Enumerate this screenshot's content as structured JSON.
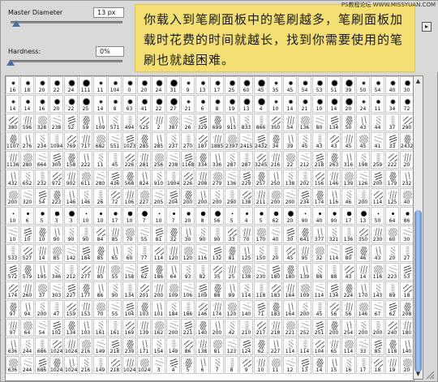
{
  "controls": {
    "master_diameter_label": "Master Diameter",
    "master_diameter_value": "13 px",
    "master_diameter_level": 0.05,
    "hardness_label": "Hardness:",
    "hardness_value": "0%",
    "hardness_level": 0.0,
    "options_icon": "options-triangle-icon"
  },
  "note": {
    "text": "你载入到笔刷面板中的笔刷越多，笔刷面板加载时花费的时间就越长，找到你需要使用的笔刷也就越困难。",
    "watermark": "PS教程论坛 WWW.MISSYUAN.COM"
  },
  "brush_grid": {
    "rows": [
      [
        "16",
        "18",
        "20",
        "22",
        "24",
        "111",
        "11",
        "104",
        "0",
        "20",
        "24",
        "31",
        "9",
        "13",
        "17",
        "25",
        "60",
        "45",
        "35",
        "45",
        "54",
        "53",
        "51",
        "39",
        "50",
        "54",
        "40",
        "30"
      ],
      [
        "14",
        "14",
        "16",
        "20",
        "22",
        "25",
        "14",
        "8",
        "63",
        "41",
        "22",
        "27",
        "21",
        "6",
        "8",
        "19",
        "13",
        "4",
        "10",
        "14",
        "21",
        "10",
        "14",
        "20",
        "24",
        "11",
        "34",
        "72"
      ],
      [
        "380",
        "596",
        "328",
        "238",
        "52",
        "59",
        "109",
        "571",
        "494",
        "525",
        "2",
        "387",
        "26",
        "329",
        "699",
        "915",
        "833",
        "866",
        "350",
        "54",
        "136",
        "80",
        "134",
        "50",
        "43",
        "44",
        "37",
        "290"
      ],
      [
        "1107",
        "276",
        "234",
        "1094",
        "769",
        "717",
        "682",
        "551",
        "1023",
        "285",
        "285",
        "237",
        "270",
        "187",
        "1885",
        "2397",
        "2415",
        "2432",
        "34",
        "39",
        "45",
        "43",
        "43",
        "45",
        "45",
        "41",
        "33",
        "2432"
      ],
      [
        "1136",
        "280",
        "664",
        "300",
        "158",
        "222",
        "11",
        "45",
        "226",
        "281",
        "256",
        "238",
        "1168",
        "334",
        "336",
        "287",
        "287",
        "3245",
        "216",
        "22",
        "212",
        "218",
        "263",
        "316",
        "198",
        "259",
        "222",
        "20"
      ],
      [
        "432",
        "652",
        "232",
        "972",
        "902",
        "611",
        "280",
        "436",
        "568",
        "824",
        "910",
        "1904",
        "226",
        "208",
        "279",
        "136",
        "229",
        "257",
        "250",
        "138",
        "202",
        "156",
        "146",
        "139",
        "126",
        "200",
        "179",
        "232"
      ],
      [
        "200",
        "320",
        "54",
        "223",
        "146",
        "146",
        "26",
        "72",
        "106",
        "227",
        "205",
        "204",
        "200",
        "200",
        "200",
        "290",
        "138",
        "211",
        "200",
        "200",
        "234",
        "174",
        "116",
        "46",
        "200",
        "114",
        "125",
        "40"
      ],
      [
        "10",
        "6",
        "5",
        "3",
        "3",
        "10",
        "10",
        "17",
        "10",
        "7",
        "10",
        "7",
        "20",
        "8",
        "56",
        "5",
        "4",
        "5",
        "62",
        "20",
        "90",
        "40",
        "90",
        "17",
        "13",
        "50",
        "64",
        "86"
      ],
      [
        "10",
        "10",
        "10",
        "90",
        "90",
        "90",
        "84",
        "85",
        "70",
        "55",
        "81",
        "32",
        "30",
        "90",
        "90",
        "33",
        "70",
        "170",
        "40",
        "30",
        "641",
        "377",
        "321",
        "136",
        "350",
        "230",
        "60",
        "30"
      ],
      [
        "533",
        "527",
        "14",
        "85",
        "142",
        "184",
        "85",
        "65",
        "60",
        "77",
        "114",
        "120",
        "120",
        "116",
        "132",
        "81",
        "125",
        "150",
        "20",
        "45",
        "95",
        "32",
        "114",
        "80",
        "46",
        "43",
        "20",
        "27"
      ],
      [
        "572",
        "579",
        "195",
        "346",
        "212",
        "277",
        "85",
        "55",
        "158",
        "62",
        "186",
        "64",
        "93",
        "82",
        "35",
        "25",
        "138",
        "230",
        "180",
        "180",
        "139",
        "88",
        "88",
        "43",
        "14",
        "116",
        "223",
        "53"
      ],
      [
        "174",
        "260",
        "37",
        "303",
        "227",
        "177",
        "86",
        "90",
        "134",
        "201",
        "200",
        "109",
        "106",
        "109",
        "88",
        "89",
        "114",
        "118",
        "183",
        "164",
        "109",
        "114",
        "134",
        "224",
        "170",
        "143",
        "89",
        "18"
      ],
      [
        "97",
        "94",
        "200",
        "47",
        "159",
        "153",
        "70",
        "55",
        "104",
        "103",
        "101",
        "184",
        "186",
        "146",
        "174",
        "120",
        "140",
        "71",
        "183",
        "164",
        "200",
        "45",
        "56",
        "56",
        "146",
        "67",
        "62",
        "208"
      ],
      [
        "97",
        "64",
        "54",
        "102",
        "134",
        "103",
        "161",
        "161",
        "169",
        "139",
        "162",
        "200",
        "221",
        "140",
        "200",
        "42",
        "210",
        "217",
        "218",
        "221",
        "252",
        "251",
        "200",
        "254",
        "200",
        "200",
        "240",
        "180"
      ],
      [
        "636",
        "244",
        "686",
        "1024",
        "1024",
        "216",
        "149",
        "218",
        "239",
        "171",
        "154",
        "149",
        "86",
        "138",
        "81",
        "123",
        "124",
        "62",
        "227",
        "114",
        "114",
        "104",
        "65",
        "114",
        "33",
        "85",
        "118",
        "140"
      ],
      [
        "636",
        "244",
        "686",
        "1024",
        "1024",
        "216",
        "149",
        "218",
        "1024",
        "1024",
        "3",
        "4",
        "5",
        "6",
        "7",
        "8",
        "9",
        "10",
        "11",
        "12",
        "13",
        "14",
        "15",
        "16",
        "17",
        "18",
        "19",
        "20"
      ]
    ]
  }
}
